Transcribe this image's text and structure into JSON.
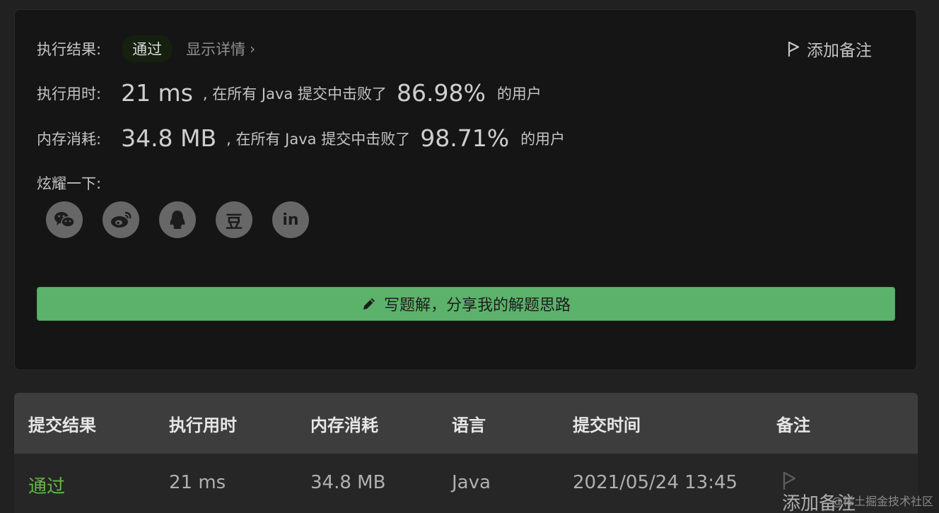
{
  "result_card": {
    "result_label": "执行结果:",
    "result_badge": "通过",
    "show_details": "显示详情",
    "show_details_chevron": "›",
    "add_note": "添加备注",
    "runtime_label": "执行用时:",
    "runtime_value": "21 ms",
    "runtime_text": ", 在所有 Java 提交中击败了",
    "runtime_percent": "86.98%",
    "runtime_suffix": "的用户",
    "memory_label": "内存消耗:",
    "memory_value": "34.8 MB",
    "memory_text": ", 在所有 Java 提交中击败了",
    "memory_percent": "98.71%",
    "memory_suffix": "的用户",
    "share_label": "炫耀一下:",
    "share_icons": [
      "wechat-icon",
      "weibo-icon",
      "qq-icon",
      "douban-icon",
      "linkedin-icon"
    ],
    "douban_glyph": "豆",
    "linkedin_glyph": "in",
    "write_solution": "写题解，分享我的解题思路",
    "accent_color": "#5cb26b"
  },
  "submissions": {
    "columns": [
      "提交结果",
      "执行用时",
      "内存消耗",
      "语言",
      "提交时间",
      "备注"
    ],
    "rows": [
      {
        "status": "通过",
        "runtime": "21 ms",
        "memory": "34.8 MB",
        "language": "Java",
        "time": "2021/05/24 13:45",
        "note": "添加备注"
      }
    ]
  },
  "watermark": "@稀土掘金技术社区"
}
